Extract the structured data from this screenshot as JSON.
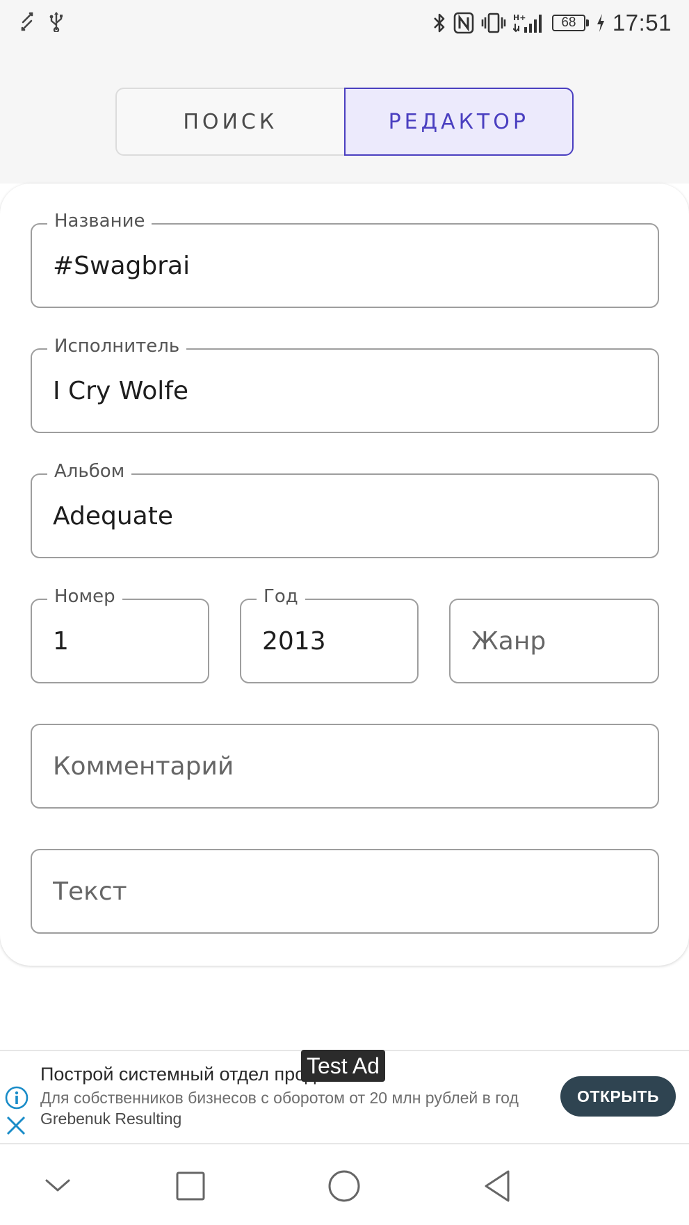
{
  "status_bar": {
    "battery": "68",
    "time": "17:51",
    "network": "H+"
  },
  "tabs": [
    {
      "label": "ПОИСК",
      "active": false
    },
    {
      "label": "РЕДАКТОР",
      "active": true
    }
  ],
  "form": {
    "title": {
      "label": "Название",
      "value": "#Swagbrai"
    },
    "artist": {
      "label": "Исполнитель",
      "value": "I Cry Wolfe"
    },
    "album": {
      "label": "Альбом",
      "value": "Adequate"
    },
    "track": {
      "label": "Номер",
      "value": "1"
    },
    "year": {
      "label": "Год",
      "value": "2013"
    },
    "genre": {
      "placeholder": "Жанр",
      "value": ""
    },
    "comment": {
      "placeholder": "Комментарий",
      "value": ""
    },
    "lyrics": {
      "placeholder": "Текст",
      "value": ""
    }
  },
  "ad": {
    "badge": "Test Ad",
    "title": "Построй системный отдел продаж",
    "description": "Для собственников бизнесов с оборотом от 20 млн рублей в год",
    "advertiser": "Grebenuk Resulting",
    "button": "ОТКРЫТЬ"
  },
  "colors": {
    "accent": "#4a3fc0",
    "accent_bg": "#eceafc",
    "ad_button": "#2f4451",
    "ad_icon": "#1a8cc8"
  },
  "icons": {
    "status_left": [
      "screen-rotate-icon",
      "usb-icon"
    ],
    "status_right": [
      "bluetooth-icon",
      "nfc-icon",
      "vibrate-icon",
      "signal-icon",
      "battery-icon",
      "charging-icon"
    ],
    "nav": [
      "chevron-down-icon",
      "recents-icon",
      "home-icon",
      "back-icon"
    ]
  }
}
